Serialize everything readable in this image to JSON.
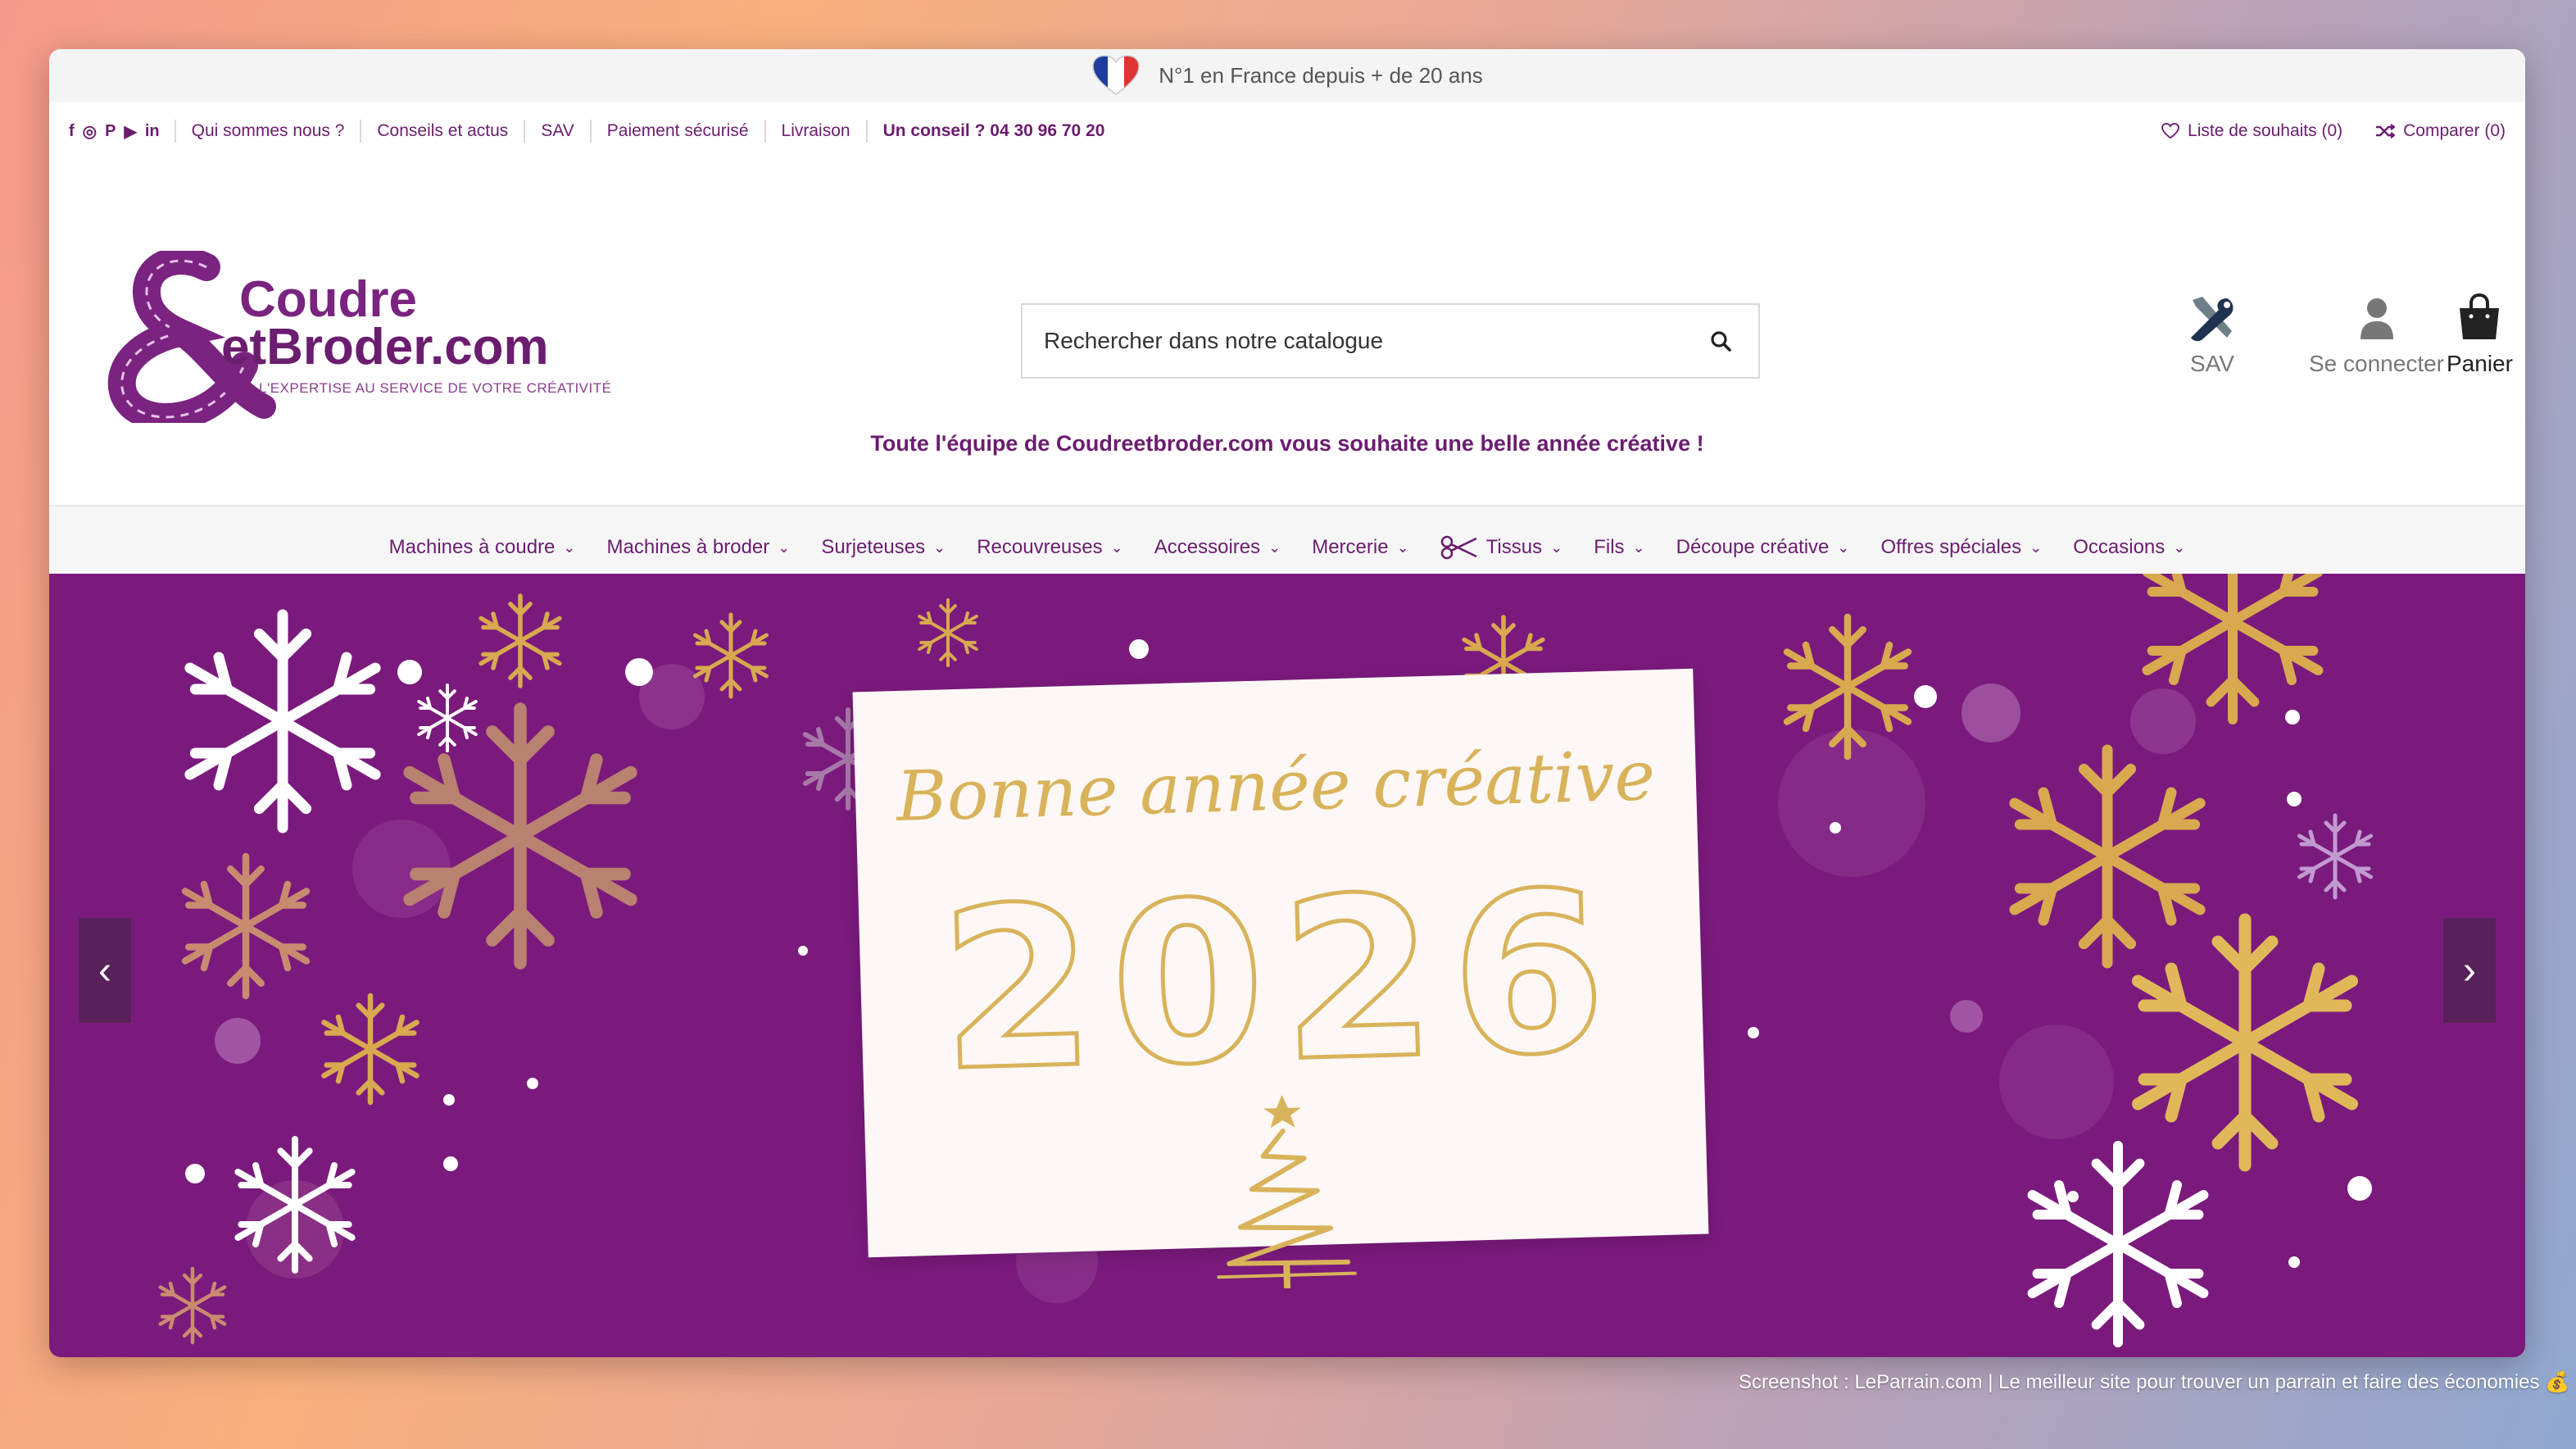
{
  "announcement": {
    "text": "N°1 en France depuis + de 20 ans",
    "flag_icon": "france-heart-flag-icon"
  },
  "utility": {
    "socials": [
      "f",
      "◎",
      "P",
      "▶",
      "in"
    ],
    "links": [
      "Qui sommes nous ?",
      "Conseils et actus",
      "SAV",
      "Paiement sécurisé",
      "Livraison"
    ],
    "phone": "Un conseil ? 04 30 96 70 20",
    "wishlist": "Liste de souhaits (0)",
    "compare": "Comparer (0)"
  },
  "logo": {
    "line1": "Coudre",
    "line2": "etBroder.com",
    "tagline": "L'EXPERTISE AU SERVICE DE VOTRE CRÉATIVITÉ"
  },
  "search": {
    "placeholder": "Rechercher dans notre catalogue"
  },
  "header_actions": {
    "sav": "SAV",
    "login": "Se connecter",
    "cart": "Panier"
  },
  "greeting": "Toute l'équipe de Coudreetbroder.com vous souhaite une belle année créative !",
  "nav": {
    "items": [
      "Machines à coudre",
      "Machines à broder",
      "Surjeteuses",
      "Recouvreuses",
      "Accessoires",
      "Mercerie",
      "Tissus",
      "Fils",
      "Découpe créative",
      "Offres spéciales",
      "Occasions"
    ]
  },
  "banner": {
    "headline": "Bonne année créative",
    "year": "2026",
    "prev_label": "‹",
    "next_label": "›"
  },
  "caption": "Screenshot : LeParrain.com | Le meilleur site pour trouver un parrain et faire des économies 💰",
  "colors": {
    "brand": "#6b1d6f",
    "banner_bg": "#7b1a7d",
    "gold": "#d8b35a"
  }
}
